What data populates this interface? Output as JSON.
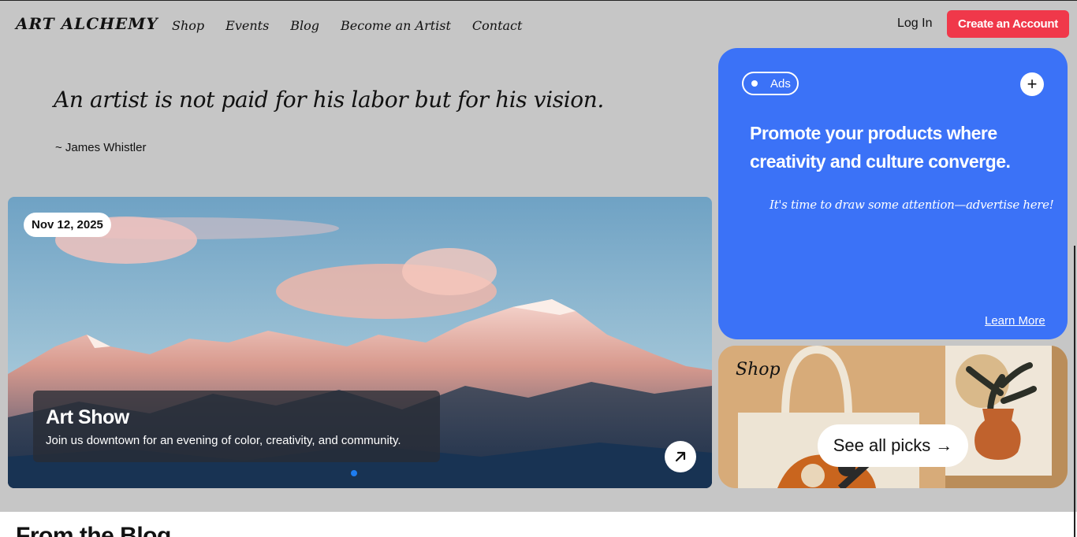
{
  "header": {
    "logo": "ART ALCHEMY",
    "nav": [
      "Shop",
      "Events",
      "Blog",
      "Become an Artist",
      "Contact"
    ],
    "login": "Log In",
    "create_account": "Create an Account"
  },
  "quote": {
    "text": "An artist is not paid for his labor but for his vision.",
    "author": "~ James Whistler"
  },
  "hero": {
    "date": "Nov 12, 2025",
    "title": "Art Show",
    "description": "Join us downtown for an evening of color, creativity, and community.",
    "arrow_icon": "arrow-up-right-icon"
  },
  "ad": {
    "badge": "Ads",
    "headline": "Promote your products where creativity and culture converge.",
    "subtext": "It's time to draw some attention—advertise here!",
    "learn_more": "Learn More"
  },
  "shop": {
    "label": "Shop",
    "cta": "See all picks",
    "cta_arrow": "→"
  },
  "blog": {
    "title": "From the Blog"
  },
  "colors": {
    "page_bg": "#c6c6c6",
    "accent_red": "#f0384a",
    "ad_blue": "#3b72f7",
    "carousel_dot": "#1e7df0"
  }
}
